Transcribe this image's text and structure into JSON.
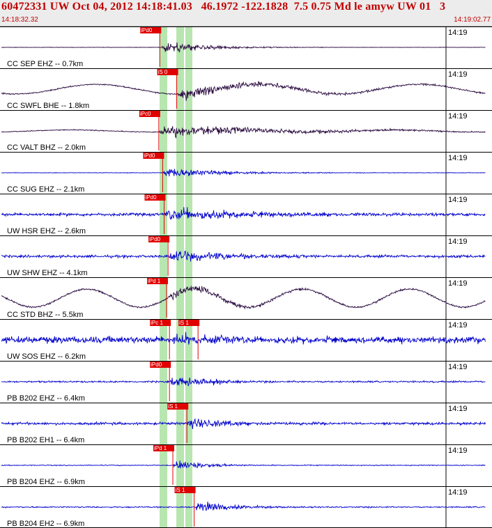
{
  "header": {
    "title": "60472331 UW Oct 04, 2012 14:18:41.03   46.1972 -122.1828  7.5 0.75 Md le amyw UW 01   3",
    "time_start": "14:18:32.32",
    "time_end": "14:19:02.77"
  },
  "colors": {
    "background": "#ffffff",
    "header_bg": "#ececec",
    "header_text": "#c00000",
    "trace_blue": "#0000cc",
    "trace_dark": "#2a0a40",
    "pick_red": "#e00000",
    "window_green": "#b8e6b0"
  },
  "tick_label": "14:19",
  "traces": [
    {
      "label": "CC SEP EHZ -- 0.7km",
      "color": "dark",
      "picks": [
        {
          "text": "iPd0",
          "t": 0.327
        }
      ]
    },
    {
      "label": "CC SWFL BHE -- 1.8km",
      "color": "dark",
      "picks": [
        {
          "text": "iS 0",
          "t": 0.362
        }
      ]
    },
    {
      "label": "CC VALT BHZ -- 2.0km",
      "color": "dark",
      "picks": [
        {
          "text": "iPc0",
          "t": 0.325
        }
      ]
    },
    {
      "label": "CC SUG EHZ -- 2.1km",
      "color": "blue",
      "picks": [
        {
          "text": "iPd0",
          "t": 0.333
        }
      ]
    },
    {
      "label": "UW HSR EHZ -- 2.6km",
      "color": "blue",
      "picks": [
        {
          "text": "iPd0",
          "t": 0.336
        }
      ]
    },
    {
      "label": "UW SHW EHZ -- 4.1km",
      "color": "blue",
      "picks": [
        {
          "text": "iPd0",
          "t": 0.344
        }
      ]
    },
    {
      "label": "CC STD BHZ -- 5.5km",
      "color": "dark",
      "picks": [
        {
          "text": "iPd 1",
          "t": 0.341
        }
      ]
    },
    {
      "label": "UW SOS EHZ -- 6.2km",
      "color": "blue",
      "picks": [
        {
          "text": "iPc 1",
          "t": 0.347
        },
        {
          "text": "iS 1",
          "t": 0.406
        }
      ]
    },
    {
      "label": "PB B202 EHZ -- 6.4km",
      "color": "blue",
      "picks": [
        {
          "text": "iPd0",
          "t": 0.347
        }
      ]
    },
    {
      "label": "PB B202 EH1 -- 6.4km",
      "color": "blue",
      "picks": [
        {
          "text": "iS 1",
          "t": 0.383
        }
      ]
    },
    {
      "label": "PB B204 EHZ -- 6.9km",
      "color": "blue",
      "picks": [
        {
          "text": "iPd 1",
          "t": 0.354
        }
      ]
    },
    {
      "label": "PB B204 EH2 -- 6.9km",
      "color": "blue",
      "picks": [
        {
          "text": "iS 1",
          "t": 0.398
        }
      ]
    }
  ]
}
